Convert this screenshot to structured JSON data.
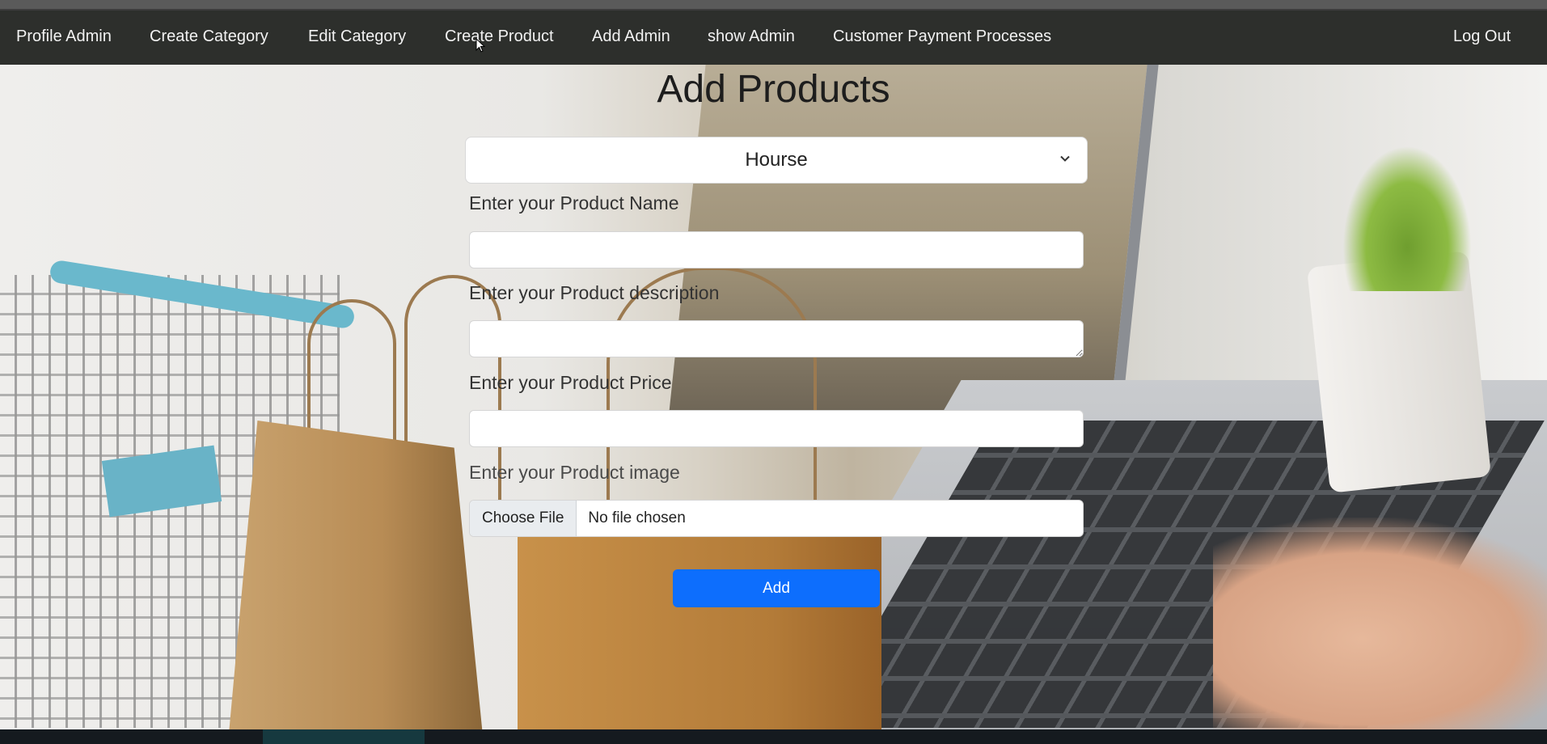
{
  "navbar": {
    "items": [
      {
        "label": "Profile Admin"
      },
      {
        "label": "Create Category"
      },
      {
        "label": "Edit Category"
      },
      {
        "label": "Create Product"
      },
      {
        "label": "Add Admin"
      },
      {
        "label": "show Admin"
      },
      {
        "label": "Customer Payment Processes"
      }
    ],
    "logout_label": "Log Out"
  },
  "form": {
    "title": "Add Products",
    "category_select": {
      "selected": "Hourse"
    },
    "fields": [
      {
        "label": "Enter your Product Name",
        "value": ""
      },
      {
        "label": "Enter your Product description",
        "value": ""
      },
      {
        "label": "Enter your Product Price",
        "value": ""
      },
      {
        "label": "Enter your Product image"
      }
    ],
    "file_input": {
      "button_label": "Choose File",
      "status": "No file chosen"
    },
    "submit_label": "Add"
  },
  "colors": {
    "navbar_bg": "#2d2f2c",
    "primary_button": "#0d6efd"
  },
  "icons": {
    "select_arrow": "chevron-down-icon",
    "mouse_cursor": "cursor-icon"
  }
}
